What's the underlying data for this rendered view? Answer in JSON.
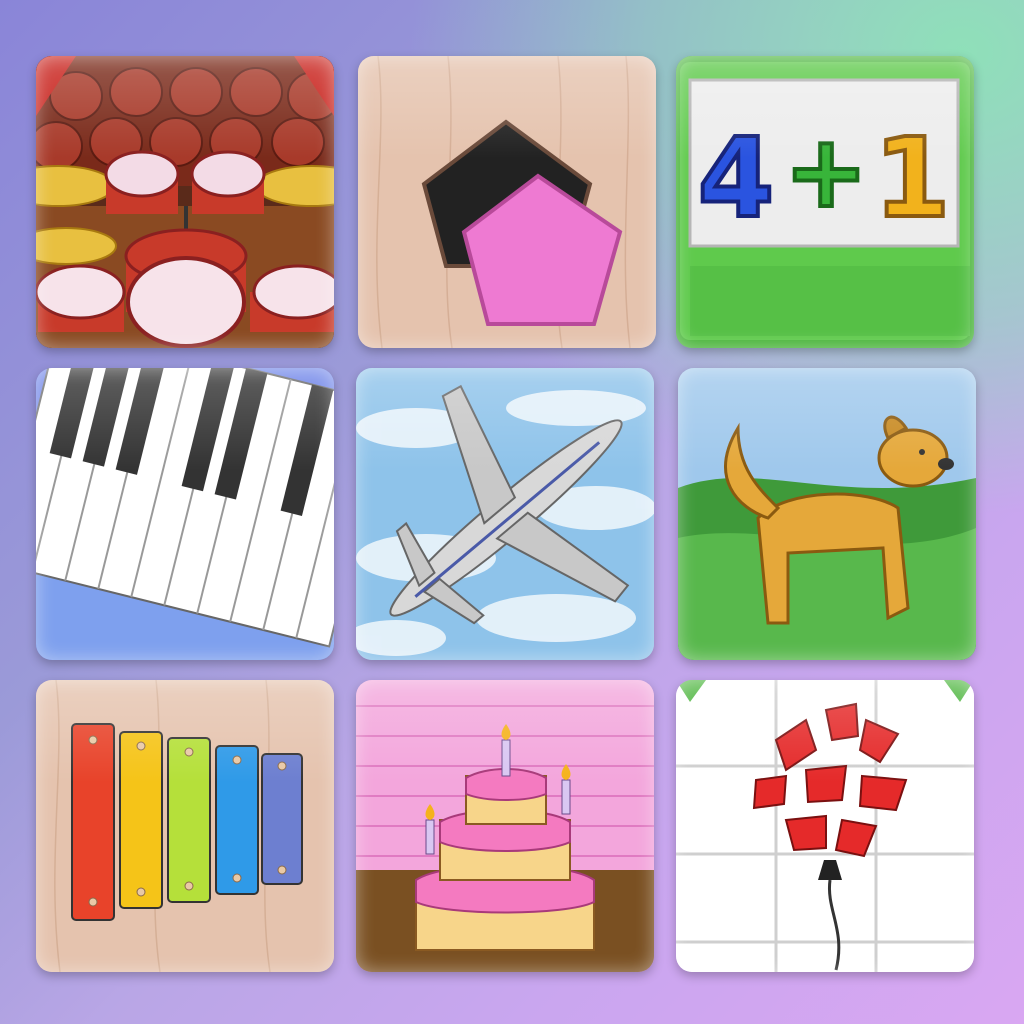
{
  "tiles": [
    {
      "id": "drums",
      "icon": "drum-kit-icon"
    },
    {
      "id": "shapes",
      "icon": "pentagon-shape-icon"
    },
    {
      "id": "math",
      "icon": "addition-board-icon",
      "equation": {
        "a": "4",
        "op": "+",
        "b": "1"
      }
    },
    {
      "id": "piano",
      "icon": "piano-keys-icon"
    },
    {
      "id": "airplane",
      "icon": "airplane-icon"
    },
    {
      "id": "dog",
      "icon": "dog-icon"
    },
    {
      "id": "xylophone",
      "icon": "xylophone-icon"
    },
    {
      "id": "cake",
      "icon": "birthday-cake-icon"
    },
    {
      "id": "balloon",
      "icon": "popped-balloon-icon"
    }
  ],
  "colors": {
    "math_a": "#2a54e0",
    "math_op": "#38b53a",
    "math_b": "#f2b21c",
    "xylophone": [
      "#e8432a",
      "#f5c418",
      "#b5e03a",
      "#2f9ae8",
      "#6d7fd0"
    ]
  }
}
